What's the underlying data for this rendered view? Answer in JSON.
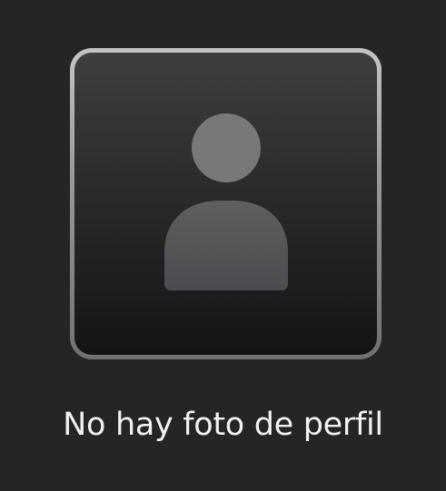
{
  "profile_photo": {
    "placeholder_icon": "person-silhouette-icon",
    "frame_color_top": "#c4c4c4",
    "frame_color_bottom": "#6e7072",
    "silhouette_head_color": "#7a7a7a",
    "silhouette_body_color": "#5a5c5f"
  },
  "caption": {
    "text": "No hay foto de perfil"
  }
}
